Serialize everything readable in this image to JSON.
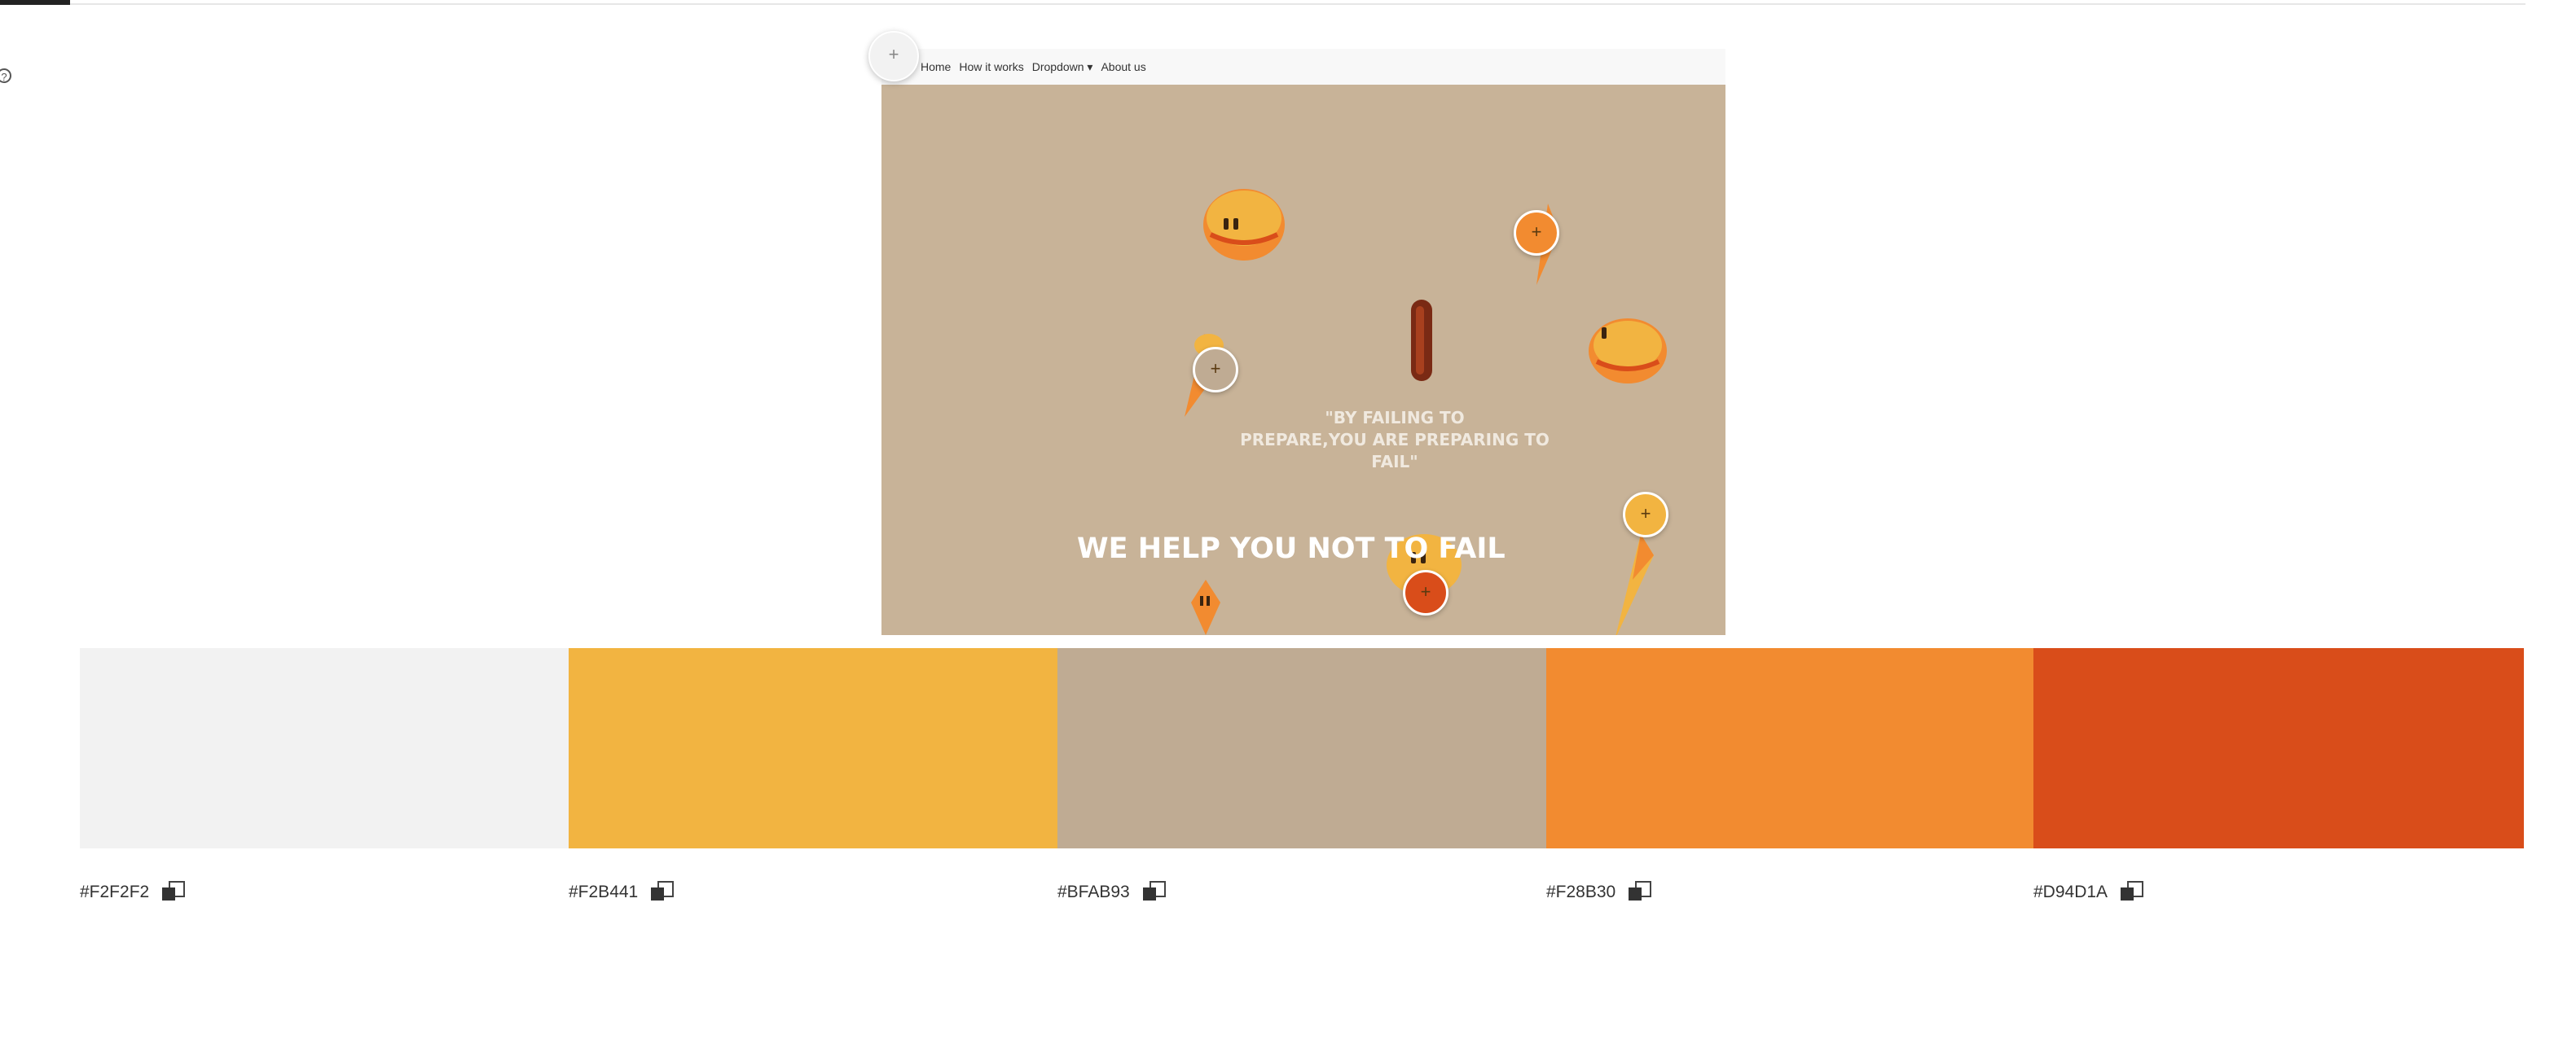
{
  "preview": {
    "nav_items": [
      "Home",
      "How it works",
      "Dropdown ▾",
      "About us"
    ],
    "quote_line1": "\"BY FAILING TO",
    "quote_line2": "PREPARE,YOU ARE PREPARING TO FAIL\"",
    "headline": "WE HELP YOU NOT TO FAIL"
  },
  "markers": {
    "plus_symbol": "+"
  },
  "palette": [
    {
      "hex": "#F2F2F2",
      "label": "#F2F2F2"
    },
    {
      "hex": "#F2B441",
      "label": "#F2B441"
    },
    {
      "hex": "#BFAB93",
      "label": "#BFAB93"
    },
    {
      "hex": "#F28B30",
      "label": "#F28B30"
    },
    {
      "hex": "#D94D1A",
      "label": "#D94D1A"
    }
  ],
  "icons": {
    "help": "help-icon",
    "copy": "copy-icon",
    "add_marker": "plus-icon"
  }
}
